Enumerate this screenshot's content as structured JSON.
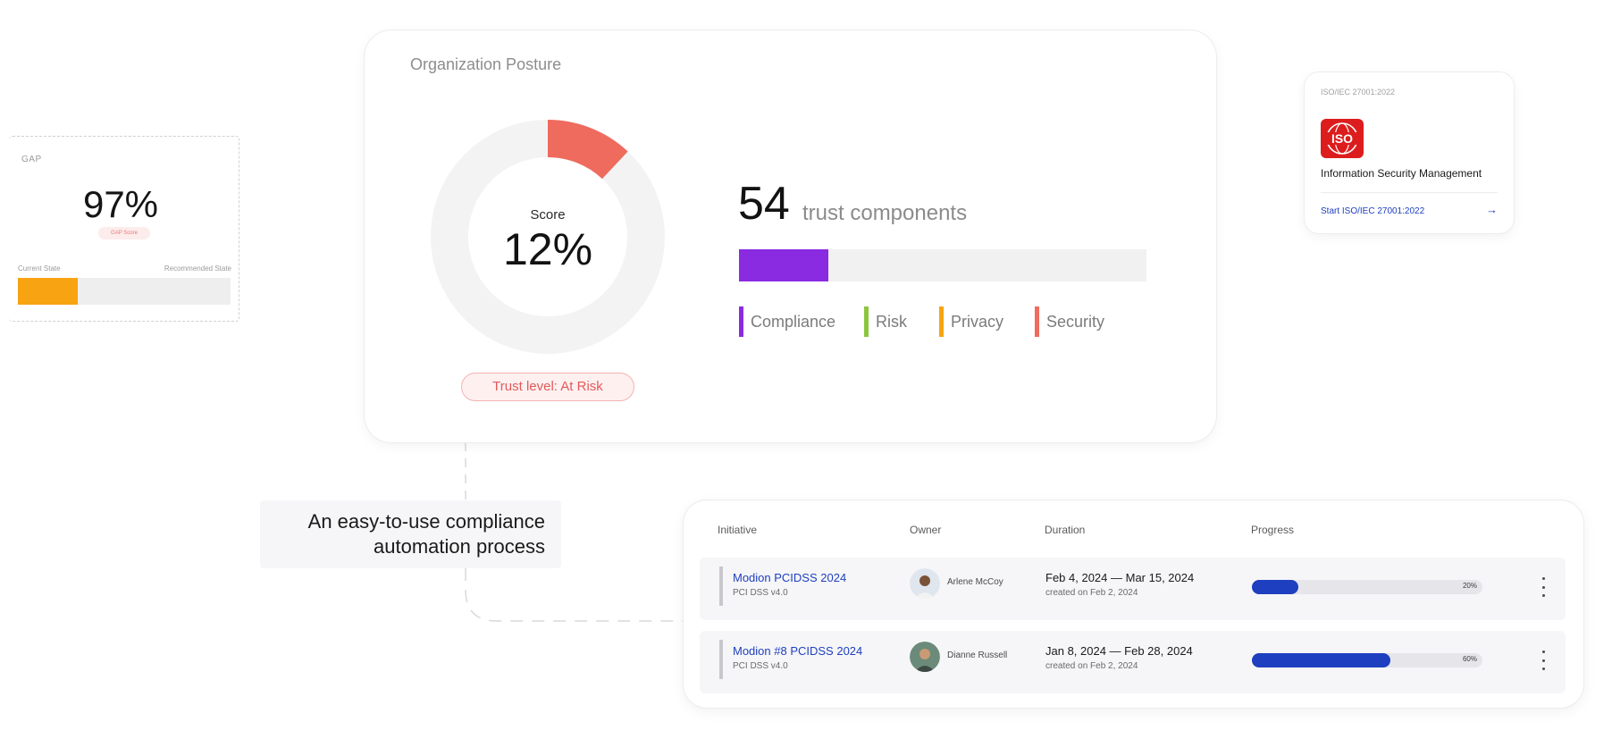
{
  "gap": {
    "title": "GAP",
    "value": "97%",
    "badge": "GAP Score",
    "label_current": "Current State",
    "label_recommended": "Recommended State",
    "progress_fraction": 0.28,
    "bar_color": "#f7a312"
  },
  "posture": {
    "title": "Organization Posture",
    "score_label": "Score",
    "score_value": "12%",
    "score_fraction": 0.12,
    "trust_badge": "Trust level: At Risk",
    "trust_components_count": "54",
    "trust_components_label": "trust components",
    "components_fill_fraction": 0.22,
    "legend": [
      {
        "label": "Compliance",
        "color": "#8a2be2"
      },
      {
        "label": "Risk",
        "color": "#8cc63f"
      },
      {
        "label": "Privacy",
        "color": "#f7a312"
      },
      {
        "label": "Security",
        "color": "#ee6b5e"
      }
    ],
    "donut_colors": {
      "track": "#f3f3f4",
      "segment": "#ee6b5e"
    }
  },
  "tagline": {
    "line1": "An easy-to-use compliance",
    "line2": "automation process"
  },
  "iso": {
    "standard": "ISO/IEC 27001:2022",
    "logo_text": "ISO",
    "name": "Information Security Management",
    "link": "Start ISO/IEC 27001:2022",
    "arrow": "→"
  },
  "table": {
    "headers": {
      "initiative": "Initiative",
      "owner": "Owner",
      "duration": "Duration",
      "progress": "Progress"
    },
    "rows": [
      {
        "name": "Modion PCIDSS 2024",
        "sub": "PCI DSS v4.0",
        "owner": "Arlene McCoy",
        "duration": "Feb 4, 2024 — Mar 15, 2024",
        "created": "created on Feb 2, 2024",
        "progress_label": "20%",
        "progress_fraction": 0.2
      },
      {
        "name": "Modion #8 PCIDSS 2024",
        "sub": "PCI DSS v4.0",
        "owner": "Dianne Russell",
        "duration": "Jan 8, 2024 — Feb 28, 2024",
        "created": "created on Feb 2, 2024",
        "progress_label": "60%",
        "progress_fraction": 0.6
      }
    ]
  }
}
